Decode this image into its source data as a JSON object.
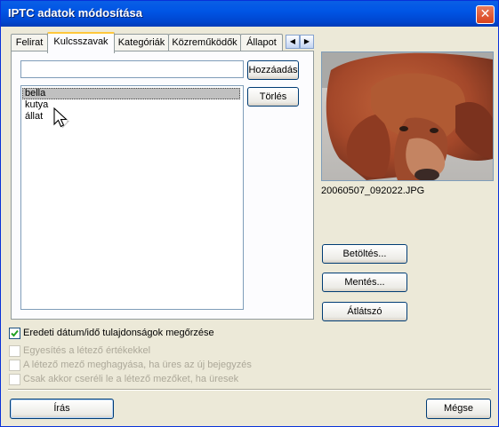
{
  "window": {
    "title": "IPTC adatok módosítása"
  },
  "tabs": [
    "Felirat",
    "Kulcsszavak",
    "Kategóriák",
    "Közreműködők",
    "Állapot"
  ],
  "active_tab": "Kulcsszavak",
  "keywords": {
    "input_value": "",
    "add_label": "Hozzáadás",
    "delete_label": "Törlés",
    "items": [
      "bella",
      "kutya",
      "állat"
    ],
    "selected": "bella"
  },
  "preview": {
    "filename": "20060507_092022.JPG"
  },
  "side_buttons": {
    "load": "Betöltés...",
    "save": "Mentés...",
    "transparent": "Átlátszó"
  },
  "options": {
    "preserve_datetime": {
      "label": "Eredeti dátum/idő tulajdonságok megőrzése",
      "checked": true
    },
    "merge": {
      "label": "Egyesítés a létező értékekkel",
      "checked": false,
      "disabled": true
    },
    "keep_if_empty": {
      "label": "A létező mező meghagyása, ha üres az új bejegyzés",
      "checked": false,
      "disabled": true
    },
    "replace_only_if_empty": {
      "label": "Csak akkor cseréli le a létező mezőket, ha üresek",
      "checked": false,
      "disabled": true
    }
  },
  "footer": {
    "write": "Írás",
    "cancel": "Mégse"
  },
  "colors": {
    "titlebar": "#0054e3",
    "dialog_bg": "#ece9d8",
    "tab_highlight": "#ffc83c",
    "checkmark": "#21a121"
  }
}
